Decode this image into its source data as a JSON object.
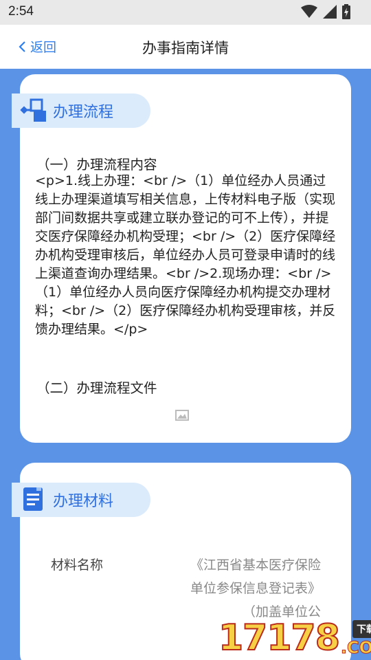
{
  "status_bar": {
    "time": "2:54"
  },
  "nav": {
    "back_label": "返回",
    "title": "办事指南详情"
  },
  "process_section": {
    "title": "办理流程",
    "heading1": "（一）办理流程内容",
    "content": "<p>1.线上办理：<br />（1）单位经办人员通过线上办理渠道填写相关信息，上传材料电子版（实现部门间数据共享或建立联办登记的可不上传），并提交医疗保障经办机构受理；<br />（2）医疗保障经办机构受理审核后，单位经办人员可登录申请时的线上渠道查询办理结果。<br />2.现场办理：<br />（1）单位经办人员向医疗保障经办机构提交办理材料；<br />（2）医疗保障经办机构受理审核，并反馈办理结果。</p>",
    "heading2": "（二）办理流程文件"
  },
  "materials_section": {
    "title": "办理材料",
    "label": "材料名称",
    "value": "《江西省基本医疗保险单位参保信息登记表》（加盖单位公"
  },
  "watermark": {
    "digits": "17178",
    "download": "下载站",
    "com": ".COM"
  },
  "colors": {
    "background": "#5b94e6",
    "accent": "#2d7ff0",
    "section_head_bg": "#dcebfb"
  }
}
